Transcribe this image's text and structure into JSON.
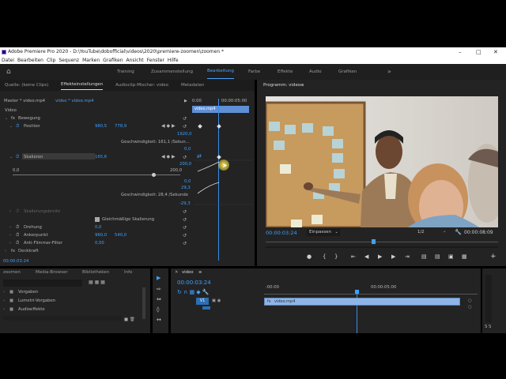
{
  "window": {
    "title": "Adobe Premiere Pro 2020 - D:\\YouTube\\dobofficial\\videos\\2020\\premiere-zoomen\\zoomen *",
    "min": "–",
    "max": "□",
    "close": "✕"
  },
  "menu": [
    "Datei",
    "Bearbeiten",
    "Clip",
    "Sequenz",
    "Marken",
    "Grafiken",
    "Ansicht",
    "Fenster",
    "Hilfe"
  ],
  "workspaces": [
    "Training",
    "Zusammenstellung",
    "Bearbeitung",
    "Farbe",
    "Effekte",
    "Audio",
    "Grafiken"
  ],
  "workspace_more": "»",
  "source_panel": {
    "tabs": [
      "Quelle: (keine Clips)",
      "Effekteinstellungen",
      "Audioclip-Mischer: video",
      "Metadaten"
    ],
    "master": "Master * video.mp4",
    "clip": "video * video.mp4",
    "ruler_start": "0:00",
    "ruler_end": "00:00:05:00",
    "clip_label": "video.mp4",
    "section_video": "Video",
    "fx_motion": "Bewegung",
    "position_label": "Position",
    "position_x": "980,5",
    "position_y": "778,9",
    "val_1920": "1920,0",
    "speed1": "Geschwindigkeit: 161,1 /Sekun...",
    "val_00a": "0,0",
    "scale_label": "Skalieren",
    "scale_value": "165,6",
    "val_2000": "200,0",
    "slider_min": "0,0",
    "slider_max": "200,0",
    "val_00b": "0,0",
    "val_293": "29,3",
    "speed2": "Geschwindigkeit: 28,4 /Sekunde",
    "val_neg293": "-29,3",
    "scale_width": "Skalierungsbreite",
    "uniform": "Gleichmäßige Skalierung",
    "rotation_label": "Drehung",
    "rotation_value": "0,0",
    "anchor_label": "Ankerpunkt",
    "anchor_x": "960,0",
    "anchor_y": "540,0",
    "flicker_label": "Anti-Flimmer-Filter",
    "flicker_value": "0,00",
    "opacity_label": "Deckkraft",
    "timecode": "00:00:03:24"
  },
  "program": {
    "title": "Programm: video",
    "timecode": "00:00:03:24",
    "fit": "Einpassen",
    "fraction": "1/2",
    "duration": "00:00:08:09"
  },
  "project": {
    "tabs": [
      "zoomen",
      "Media-Browser",
      "Bibliotheken",
      "Info"
    ],
    "items": [
      "Vorgaben",
      "Lumetri-Vorgaben",
      "Audioeffekte"
    ]
  },
  "timeline": {
    "title": "video",
    "timecode": "00:00:03:24",
    "ruler_start": ":00:00",
    "ruler_mid": "00:00:05:00",
    "track": "V1",
    "clip": "video.mp4",
    "meter_label": "S S"
  },
  "colors": {
    "accent": "#3ea0ff",
    "bg": "#232323"
  }
}
